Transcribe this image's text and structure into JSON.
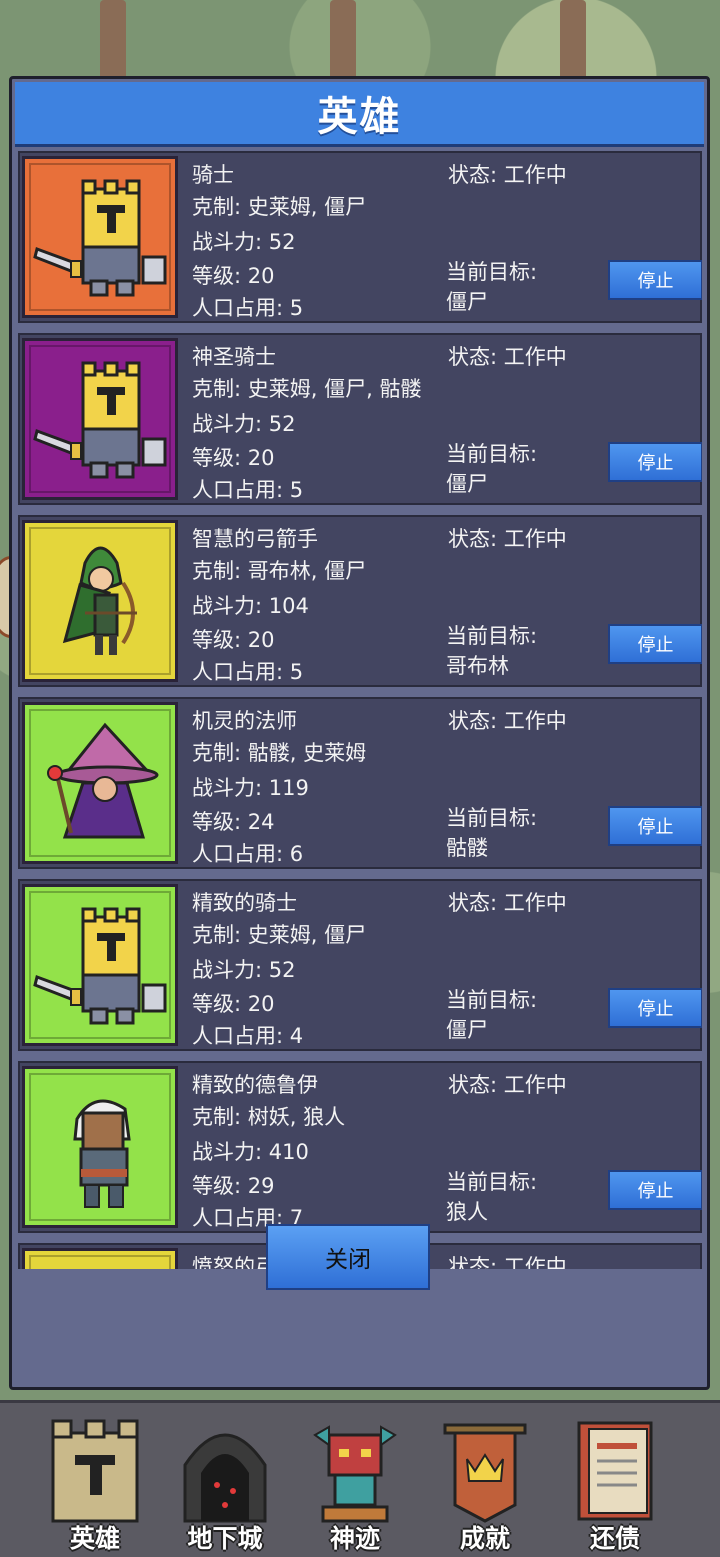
{
  "panel": {
    "title": "英雄",
    "close_label": "关闭"
  },
  "labels": {
    "status_prefix": "状态: ",
    "counter_prefix": "克制: ",
    "power_prefix": "战斗力: ",
    "level_prefix": "等级: ",
    "pop_prefix": "人口占用: ",
    "target_label": "当前目标:",
    "stop": "停止"
  },
  "heroes": [
    {
      "name": "骑士",
      "counter": "史莱姆, 僵尸",
      "power": "52",
      "level": "20",
      "pop": "5",
      "status": "工作中",
      "target": "僵尸",
      "bg": "#e8703a",
      "portrait": "knight-icon"
    },
    {
      "name": "神圣骑士",
      "counter": "史莱姆, 僵尸, 骷髅",
      "power": "52",
      "level": "20",
      "pop": "5",
      "status": "工作中",
      "target": "僵尸",
      "bg": "#8a1f8c",
      "portrait": "knight-icon"
    },
    {
      "name": "智慧的弓箭手",
      "counter": "哥布林, 僵尸",
      "power": "104",
      "level": "20",
      "pop": "5",
      "status": "工作中",
      "target": "哥布林",
      "bg": "#e4d63b",
      "portrait": "archer-icon"
    },
    {
      "name": "机灵的法师",
      "counter": "骷髅, 史莱姆",
      "power": "119",
      "level": "24",
      "pop": "6",
      "status": "工作中",
      "target": "骷髅",
      "bg": "#93e24a",
      "portrait": "mage-icon"
    },
    {
      "name": "精致的骑士",
      "counter": "史莱姆, 僵尸",
      "power": "52",
      "level": "20",
      "pop": "4",
      "status": "工作中",
      "target": "僵尸",
      "bg": "#93e24a",
      "portrait": "knight-icon"
    },
    {
      "name": "精致的德鲁伊",
      "counter": "树妖, 狼人",
      "power": "410",
      "level": "29",
      "pop": "7",
      "status": "工作中",
      "target": "狼人",
      "bg": "#93e24a",
      "portrait": "druid-icon"
    },
    {
      "name": "愤怒的弓箭手",
      "status": "工作中",
      "bg": "#e4d63b",
      "portrait": "archer-icon"
    }
  ],
  "nav": [
    {
      "label": "英雄",
      "icon": "castle-icon"
    },
    {
      "label": "地下城",
      "icon": "dungeon-gate-icon"
    },
    {
      "label": "神迹",
      "icon": "totem-icon"
    },
    {
      "label": "成就",
      "icon": "crown-banner-icon"
    },
    {
      "label": "还债",
      "icon": "scroll-book-icon"
    }
  ]
}
